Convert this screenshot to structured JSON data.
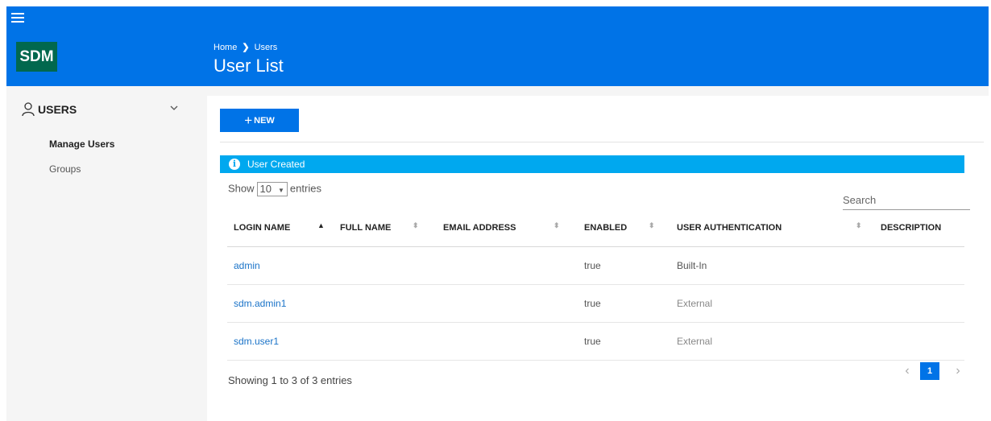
{
  "header": {
    "logo": "SDM",
    "breadcrumb": [
      "Home",
      "Users"
    ],
    "title": "User List"
  },
  "sidebar": {
    "section_label": "USERS",
    "items": [
      {
        "label": "Manage Users",
        "active": true
      },
      {
        "label": "Groups",
        "active": false
      }
    ]
  },
  "toolbar": {
    "new_label": "NEW"
  },
  "alert": {
    "message": "User Created"
  },
  "table_controls": {
    "show_label": "Show",
    "page_length": "10",
    "entries_label": "entries",
    "search_placeholder": "Search"
  },
  "table": {
    "columns": [
      "LOGIN NAME",
      "FULL NAME",
      "EMAIL ADDRESS",
      "ENABLED",
      "USER AUTHENTICATION",
      "DESCRIPTION"
    ],
    "sorted_column": "LOGIN NAME",
    "rows": [
      {
        "login": "admin",
        "full_name": "",
        "email": "",
        "enabled": "true",
        "auth": "Built-In",
        "description": ""
      },
      {
        "login": "sdm.admin1",
        "full_name": "",
        "email": "",
        "enabled": "true",
        "auth": "External",
        "description": ""
      },
      {
        "login": "sdm.user1",
        "full_name": "",
        "email": "",
        "enabled": "true",
        "auth": "External",
        "description": ""
      }
    ]
  },
  "footer": {
    "info": "Showing 1 to 3 of 3 entries",
    "current_page": "1"
  },
  "colors": {
    "brand": "#0073e7",
    "logo_bg": "#01684e",
    "alert": "#00a8ef"
  }
}
